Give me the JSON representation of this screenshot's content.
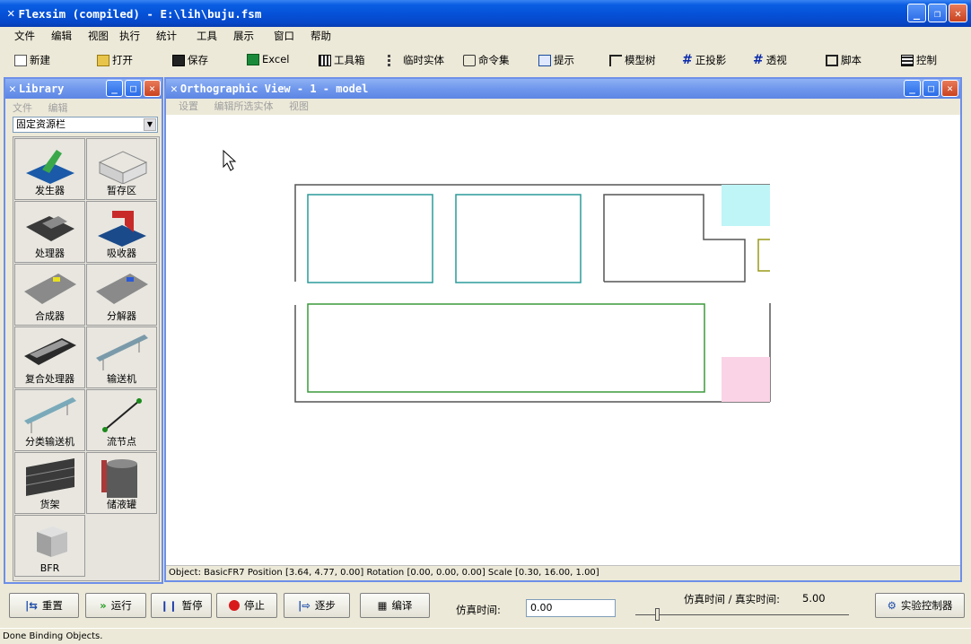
{
  "window": {
    "title": "Flexsim (compiled) - E:\\lih\\buju.fsm"
  },
  "menu": [
    "文件",
    "编辑",
    "视图",
    "执行",
    "统计",
    "工具",
    "展示",
    "窗口",
    "帮助"
  ],
  "toolbar": {
    "new": "新建",
    "open": "打开",
    "save": "保存",
    "excel": "Excel",
    "toolbox": "工具箱",
    "temp_entity": "临时实体",
    "command_set": "命令集",
    "hint": "提示",
    "model_tree": "模型树",
    "ortho": "正投影",
    "perspective": "透视",
    "script": "脚本",
    "control": "控制"
  },
  "library": {
    "title": "Library",
    "menu": [
      "文件",
      "编辑"
    ],
    "dropdown_value": "固定资源栏",
    "items": [
      "发生器",
      "暂存区",
      "处理器",
      "吸收器",
      "合成器",
      "分解器",
      "复合处理器",
      "输送机",
      "分类输送机",
      "流节点",
      "货架",
      "储液罐",
      "BFR"
    ]
  },
  "ortho": {
    "title": "Orthographic View - 1 - model",
    "menu": [
      "设置",
      "编辑所选实体",
      "视图"
    ],
    "status": "Object: BasicFR7 Position [3.64, 4.77, 0.00] Rotation [0.00, 0.00, 0.00] Scale [0.30, 16.00, 1.00]"
  },
  "controls": {
    "reset": "重置",
    "run": "运行",
    "pause": "暂停",
    "stop": "停止",
    "step": "逐步",
    "compile": "编译",
    "sim_time_label": "仿真时间:",
    "sim_time_value": "0.00",
    "ratio_label": "仿真时间 / 真实时间:",
    "ratio_value": "5.00",
    "experiment": "实验控制器"
  },
  "colors": {
    "titlebar": "#0a5ee3",
    "teal_box": "#2a9a9a",
    "green_box": "#3a9a3a",
    "cyan_fill": "#bff5f7",
    "pink_fill": "#fbd3e6",
    "olive": "#9a9a1a"
  },
  "status_bar": "Done Binding Objects."
}
